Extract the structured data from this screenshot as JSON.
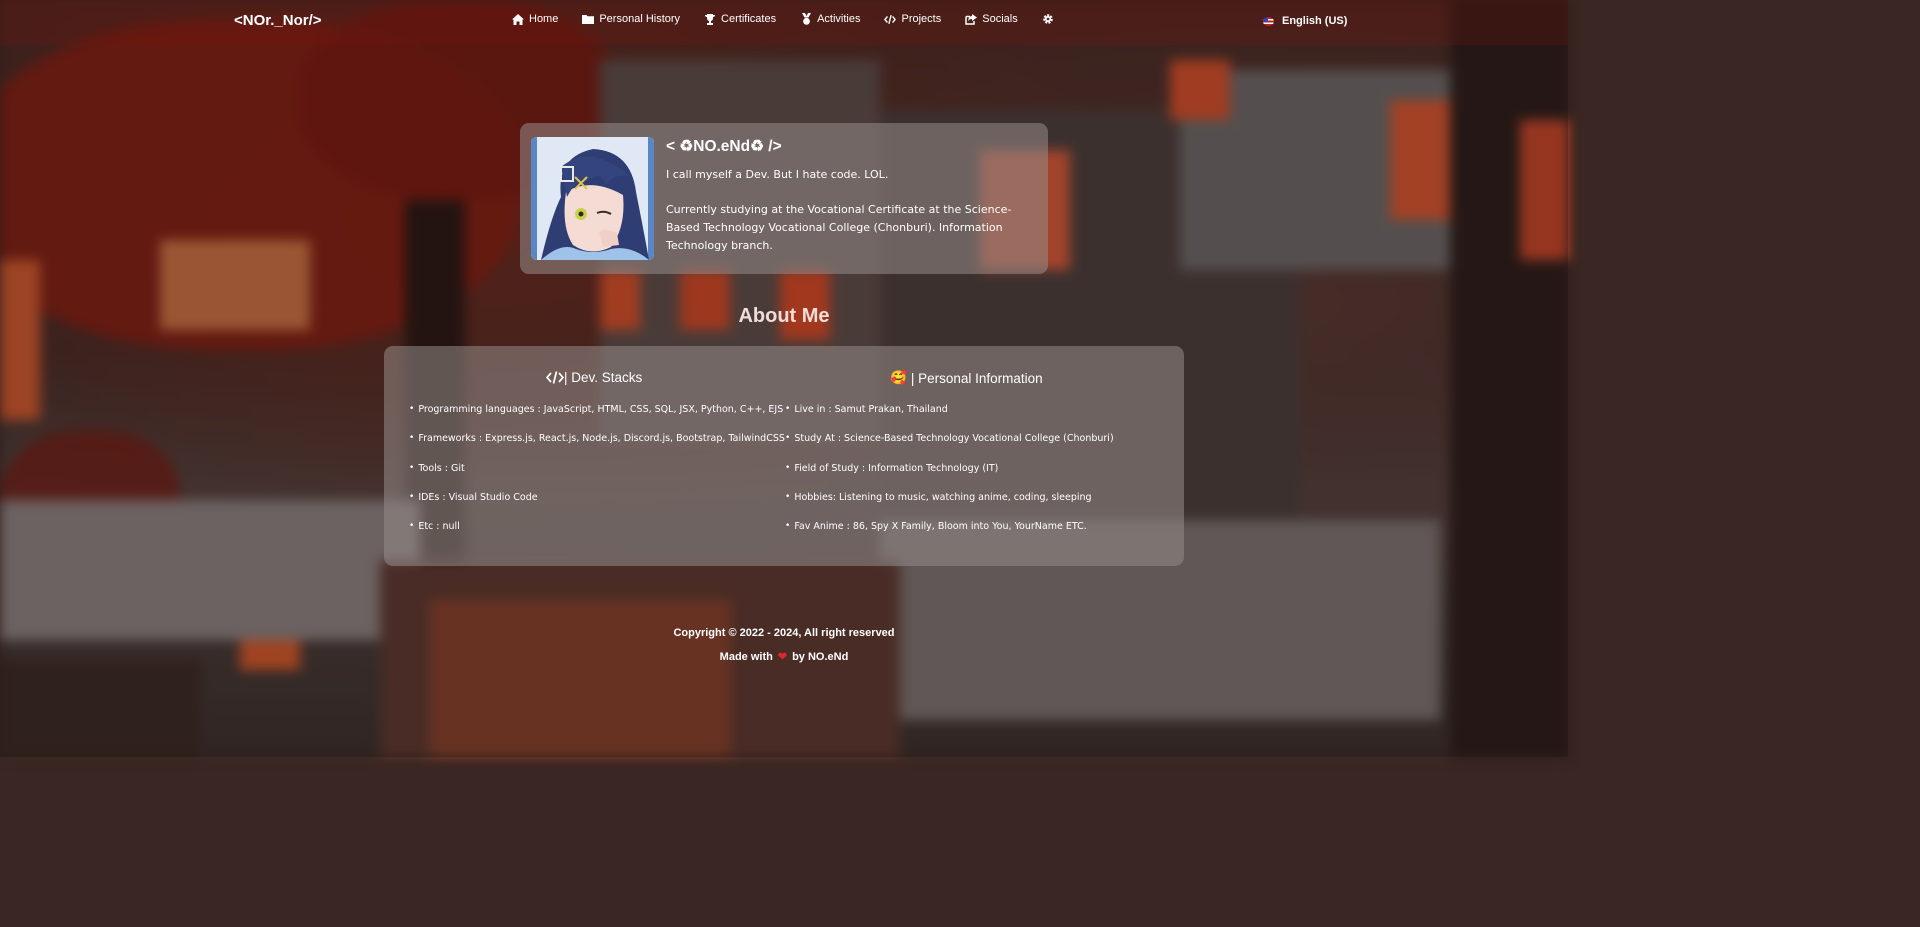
{
  "nav": {
    "brand": "<NOr._Nor/>",
    "items": [
      {
        "label": "Home",
        "icon": "home-icon"
      },
      {
        "label": "Personal History",
        "icon": "folder-icon"
      },
      {
        "label": "Certificates",
        "icon": "trophy-icon"
      },
      {
        "label": "Activities",
        "icon": "medal-icon"
      },
      {
        "label": "Projects",
        "icon": "code-icon"
      },
      {
        "label": "Socials",
        "icon": "share-icon"
      }
    ],
    "settings_icon": "gear-icon",
    "language": "English (US)"
  },
  "profile": {
    "name": "< ♻NO.eNd♻ />",
    "line1": "I call myself a Dev. But I hate code. LOL.",
    "line2": "Currently studying at the Vocational Certificate at the Science-Based Technology Vocational College (Chonburi). Information Technology branch."
  },
  "about": {
    "title": "About Me",
    "dev": {
      "title": "| Dev. Stacks",
      "items": [
        "Programming languages : JavaScript, HTML, CSS, SQL, JSX, Python, C++, EJS",
        "Frameworks : Express.js, React.js, Node.js, Discord.js, Bootstrap, TailwindCSS",
        "Tools : Git",
        "IDEs : Visual Studio Code",
        "Etc : null"
      ]
    },
    "personal": {
      "emoji": "🥰",
      "title": "| Personal Information",
      "items": [
        "Live in : Samut Prakan, Thailand",
        "Study At : Science-Based Technology Vocational College (Chonburi)",
        "Field of Study : Information Technology (IT)",
        "Hobbies: Listening to music, watching anime, coding, sleeping",
        "Fav Anime : 86, Spy X Family, Bloom into You, YourName ETC."
      ]
    }
  },
  "footer": {
    "copyright": "Copyright © 2022 - 2024, All right reserved",
    "made_with": "Made with",
    "by": "by",
    "author": "NO.eNd"
  },
  "colors": {
    "heart": "#e0252c",
    "card_bg": "rgba(150,140,138,0.55)"
  }
}
